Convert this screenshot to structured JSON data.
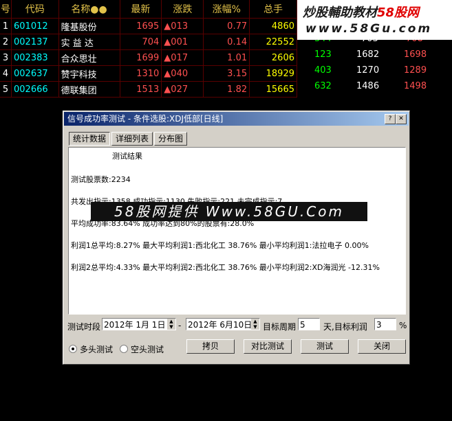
{
  "table": {
    "headers": [
      "号",
      "代码",
      "名称●●",
      "最新",
      "涨跌",
      "涨幅%",
      "总手"
    ],
    "rows": [
      {
        "num": "1",
        "code": "601012",
        "name": "隆基股份",
        "price": "1695",
        "chg": "▲013",
        "pct": "0.77",
        "vol": "4860"
      },
      {
        "num": "2",
        "code": "002137",
        "name": "实 益 达",
        "price": "704",
        "chg": "▲001",
        "pct": "0.14",
        "vol": "22552"
      },
      {
        "num": "3",
        "code": "002383",
        "name": "合众思壮",
        "price": "1699",
        "chg": "▲017",
        "pct": "1.01",
        "vol": "2606"
      },
      {
        "num": "4",
        "code": "002637",
        "name": "赞宇科技",
        "price": "1310",
        "chg": "▲040",
        "pct": "3.15",
        "vol": "18929"
      },
      {
        "num": "5",
        "code": "002666",
        "name": "德联集团",
        "price": "1513",
        "chg": "▲027",
        "pct": "1.82",
        "vol": "15665"
      }
    ],
    "extra_rows": [
      {
        "a": "",
        "b": "",
        "c": ""
      },
      {
        "a": "344",
        "b": "703",
        "c": "708"
      },
      {
        "a": "123",
        "b": "1682",
        "c": "1698"
      },
      {
        "a": "403",
        "b": "1270",
        "c": "1289"
      },
      {
        "a": "632",
        "b": "1486",
        "c": "1498"
      }
    ]
  },
  "brand": {
    "title_a": "炒股輔助教材",
    "title_b": "58股网",
    "url": "www.58Gu.com"
  },
  "dialog": {
    "title": "信号成功率测试 - 条件选股:XDJ低部[日线]",
    "tabs": [
      "统计数据",
      "详细列表",
      "分布图"
    ],
    "results": {
      "heading": "测试结果",
      "line1": "测试股票数:2234",
      "line2": "共发出指示:1358 成功指示:1130 失败指示:221 未完成指示:7",
      "line3": "平均成功率:83.64% 成功率达到80%的股票有:28.0%",
      "line4": "利润1总平均:8.27% 最大平均利润1:西北化工 38.76% 最小平均利润1:法拉电子 0.00%",
      "line5": "利润2总平均:4.33% 最大平均利润2:西北化工 38.76% 最小平均利润2:XD海润光 -12.31%"
    },
    "period_label": "测试时段",
    "date_from": "2012年 1月 1日",
    "dash": "-",
    "date_to": "2012年 6月10日",
    "target_period_label": "目标周期",
    "target_period_value": "5",
    "days_label": "天,目标利润",
    "target_profit_value": "3",
    "pct_label": "%",
    "radio_long": "多头测试",
    "radio_short": "空头测试",
    "buttons": {
      "copy": "拷贝",
      "compare": "对比测试",
      "test": "测试",
      "close": "关闭"
    }
  },
  "watermark": "58股网提供 Www.58GU.Com"
}
